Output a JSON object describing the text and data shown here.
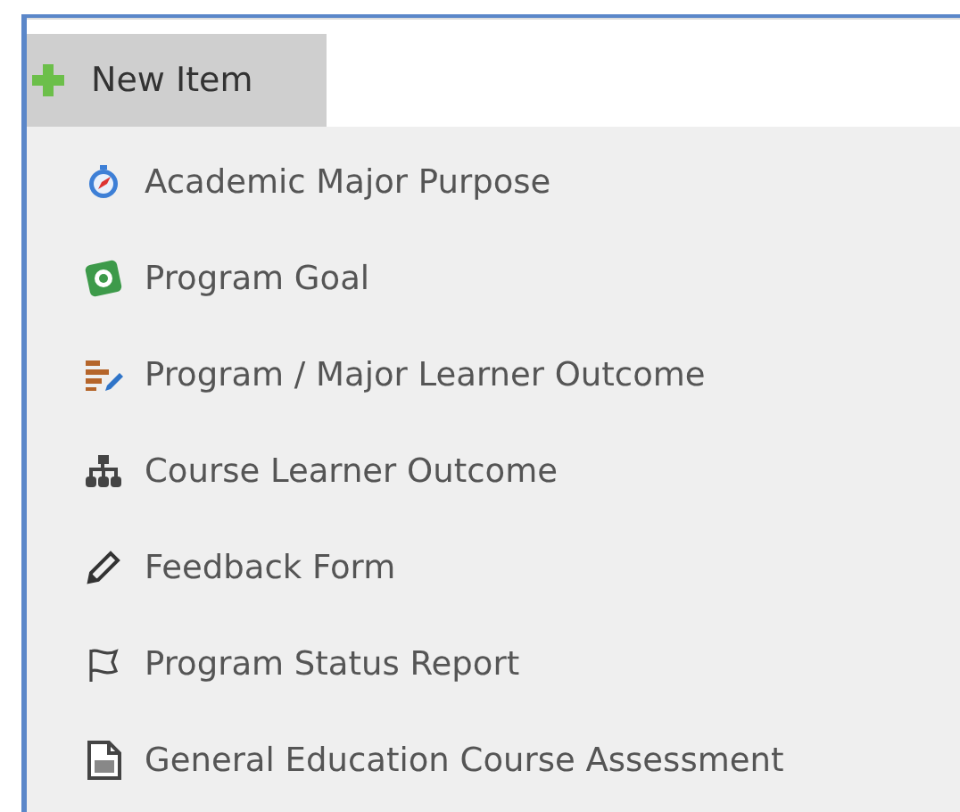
{
  "new_item_button": {
    "label": "New Item"
  },
  "menu": {
    "items": [
      {
        "label": "Academic Major Purpose",
        "kind": "compass"
      },
      {
        "label": "Program Goal",
        "kind": "gear"
      },
      {
        "label": "Program / Major Learner Outcome",
        "kind": "list"
      },
      {
        "label": "Course Learner Outcome",
        "kind": "hierarchy"
      },
      {
        "label": "Feedback Form",
        "kind": "pencil"
      },
      {
        "label": "Program Status Report",
        "kind": "flag"
      },
      {
        "label": "General Education Course Assessment",
        "kind": "document"
      }
    ]
  }
}
